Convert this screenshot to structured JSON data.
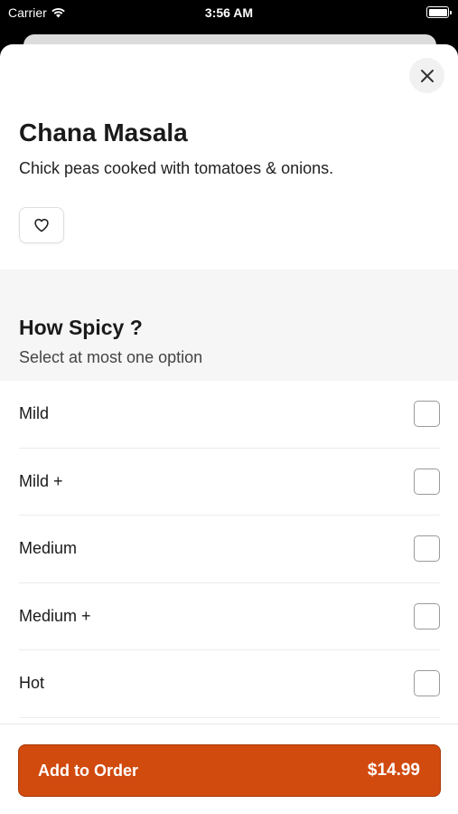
{
  "status_bar": {
    "carrier": "Carrier",
    "time": "3:56 AM"
  },
  "item": {
    "title": "Chana Masala",
    "description": "Chick peas cooked with tomatoes & onions."
  },
  "spice_section": {
    "title": "How Spicy ?",
    "subtitle": "Select at most one option",
    "options": [
      {
        "label": "Mild",
        "checked": false
      },
      {
        "label": "Mild +",
        "checked": false
      },
      {
        "label": "Medium",
        "checked": false
      },
      {
        "label": "Medium +",
        "checked": false
      },
      {
        "label": "Hot",
        "checked": false
      }
    ]
  },
  "footer": {
    "add_label": "Add to Order",
    "price": "$14.99"
  },
  "colors": {
    "accent": "#d14a0e",
    "section_bg": "#f6f6f6"
  },
  "icons": {
    "close": "close-icon",
    "favorite": "heart-icon",
    "wifi": "wifi-icon",
    "battery": "battery-icon"
  }
}
